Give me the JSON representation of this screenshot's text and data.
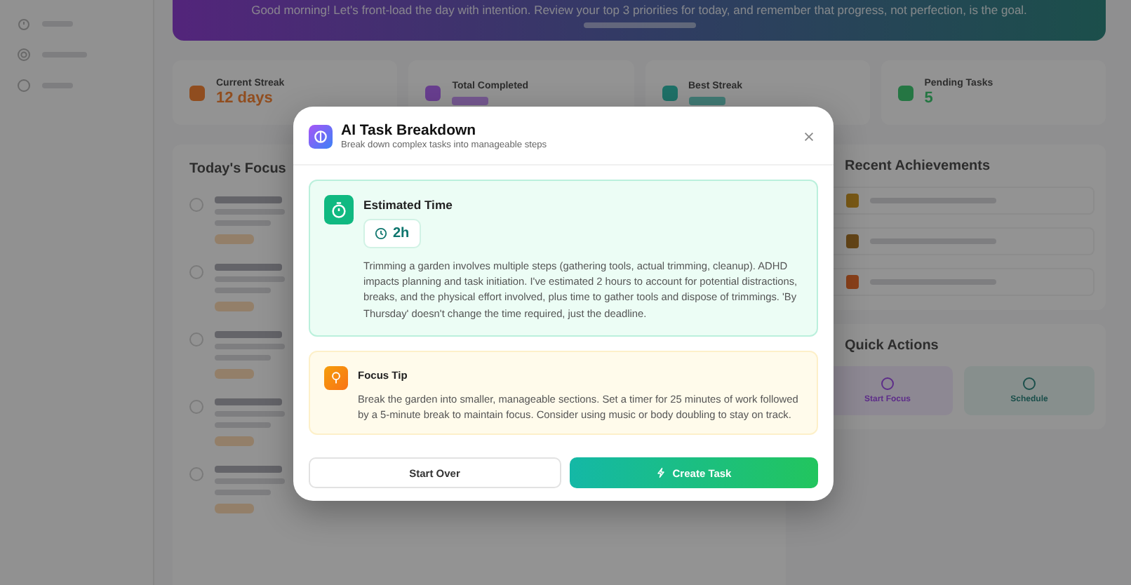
{
  "background": {
    "banner": {
      "message": "Good morning! Let's front-load the day with intention. Review your top 3 priorities for today, and remember that progress, not perfection, is the goal."
    },
    "stats": [
      {
        "label": "Current Streak",
        "value": "12 days"
      },
      {
        "label": "Total Completed"
      },
      {
        "label": "Best Streak"
      },
      {
        "label": "Pending Tasks",
        "value": "5"
      }
    ],
    "focus": {
      "title": "Today's Focus",
      "tasks": [
        {
          "checked": false
        },
        {
          "checked": false
        },
        {
          "checked": false
        },
        {
          "checked": false
        },
        {
          "checked": false
        }
      ]
    },
    "achievements": {
      "title": "Recent Achievements"
    },
    "quick_actions": {
      "title": "Quick Actions",
      "items": [
        {
          "label": "Start Focus",
          "kind": "focus"
        },
        {
          "label": "Schedule",
          "kind": "schedule"
        }
      ]
    }
  },
  "modal": {
    "title": "AI Task Breakdown",
    "subtitle": "Break down complex tasks into manageable steps",
    "estimate": {
      "title": "Estimated Time",
      "duration": "2h",
      "explanation": "Trimming a garden involves multiple steps (gathering tools, actual trimming, cleanup). ADHD impacts planning and task initiation. I've estimated 2 hours to account for potential distractions, breaks, and the physical effort involved, plus time to gather tools and dispose of trimmings. 'By Thursday' doesn't change the time required, just the deadline."
    },
    "tip": {
      "title": "Focus Tip",
      "text": "Break the garden into smaller, manageable sections. Set a timer for 25 minutes of work followed by a 5-minute break to maintain focus. Consider using music or body doubling to stay on track."
    },
    "buttons": [
      {
        "label": "Start Over",
        "kind": "secondary"
      },
      {
        "label": "Create Task",
        "kind": "primary"
      }
    ]
  }
}
